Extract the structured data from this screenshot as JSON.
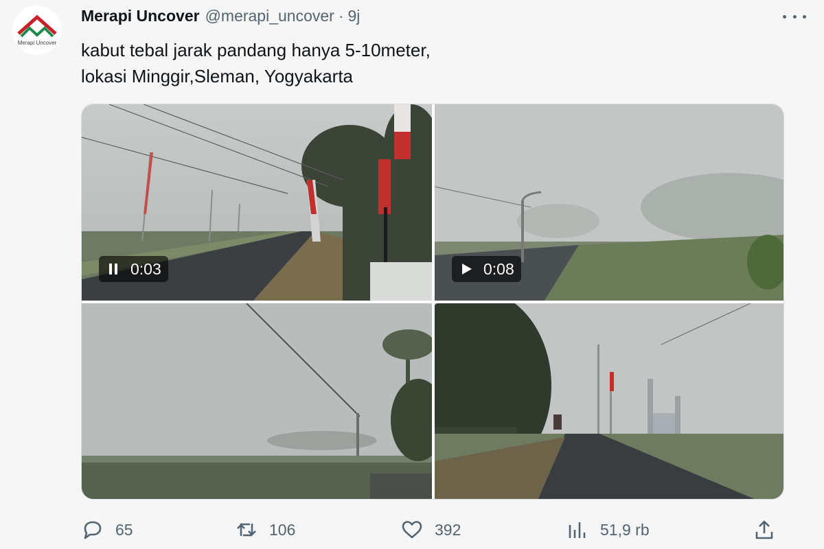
{
  "account": {
    "name": "Merapi Uncover",
    "handle": "@merapi_uncover",
    "separator": "·",
    "time": "9j",
    "avatar_label": "Merapi Uncover"
  },
  "tweet": {
    "lines": [
      "kabut tebal jarak pandang hanya 5-10meter,",
      "lokasi Minggir,Sleman, Yogyakarta"
    ]
  },
  "media": [
    {
      "kind": "video",
      "state": "playing",
      "duration": "0:03",
      "icon": "pause-icon"
    },
    {
      "kind": "video",
      "state": "paused",
      "duration": "0:08",
      "icon": "play-icon"
    },
    {
      "kind": "photo"
    },
    {
      "kind": "photo"
    }
  ],
  "actions": {
    "replies": "65",
    "retweets": "106",
    "likes": "392",
    "views": "51,9 rb"
  },
  "icons": [
    "reply-icon",
    "retweet-icon",
    "like-icon",
    "views-icon",
    "share-icon",
    "more-icon"
  ],
  "colors": {
    "text": "#0f1419",
    "muted": "#536471",
    "logo_red": "#c8202a",
    "logo_green": "#1a8a4a"
  }
}
